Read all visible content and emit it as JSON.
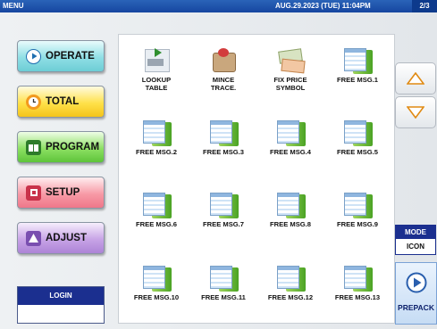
{
  "header": {
    "menu": "MENU",
    "datetime": "AUG.29.2023 (TUE) 11:04PM",
    "page": "2/3"
  },
  "nav": [
    {
      "label": "OPERATE",
      "icon": "operate-icon"
    },
    {
      "label": "TOTAL",
      "icon": "clock-icon"
    },
    {
      "label": "PROGRAM",
      "icon": "book-icon"
    },
    {
      "label": "SETUP",
      "icon": "setup-icon"
    },
    {
      "label": "ADJUST",
      "icon": "scale-icon"
    }
  ],
  "login": {
    "label": "LOGIN",
    "value": ""
  },
  "items": [
    {
      "l1": "LOOKUP",
      "l2": "TABLE",
      "icon": "lookup-table-icon"
    },
    {
      "l1": "MINCE",
      "l2": "TRACE.",
      "icon": "mince-trace-icon"
    },
    {
      "l1": "FIX PRICE",
      "l2": "SYMBOL",
      "icon": "fix-price-symbol-icon"
    },
    {
      "l1": "FREE MSG.1",
      "l2": "",
      "icon": "free-msg-icon"
    },
    {
      "l1": "FREE MSG.2",
      "l2": "",
      "icon": "free-msg-icon"
    },
    {
      "l1": "FREE MSG.3",
      "l2": "",
      "icon": "free-msg-icon"
    },
    {
      "l1": "FREE MSG.4",
      "l2": "",
      "icon": "free-msg-icon"
    },
    {
      "l1": "FREE MSG.5",
      "l2": "",
      "icon": "free-msg-icon"
    },
    {
      "l1": "FREE MSG.6",
      "l2": "",
      "icon": "free-msg-icon"
    },
    {
      "l1": "FREE MSG.7",
      "l2": "",
      "icon": "free-msg-icon"
    },
    {
      "l1": "FREE MSG.8",
      "l2": "",
      "icon": "free-msg-icon"
    },
    {
      "l1": "FREE MSG.9",
      "l2": "",
      "icon": "free-msg-icon"
    },
    {
      "l1": "FREE MSG.10",
      "l2": "",
      "icon": "free-msg-icon"
    },
    {
      "l1": "FREE MSG.11",
      "l2": "",
      "icon": "free-msg-icon"
    },
    {
      "l1": "FREE MSG.12",
      "l2": "",
      "icon": "free-msg-icon"
    },
    {
      "l1": "FREE MSG.13",
      "l2": "",
      "icon": "free-msg-icon"
    }
  ],
  "mode": {
    "title": "MODE",
    "value": "ICON"
  },
  "prepack": {
    "label": "PREPACK"
  }
}
